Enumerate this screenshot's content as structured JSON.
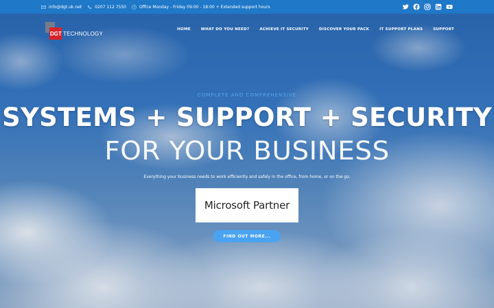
{
  "topbar": {
    "email": "info@dgt.uk.net",
    "phone": "0207 112 7550",
    "hours": "Office Monday - Friday 09:00 - 18:00 + Extended support hours",
    "social_icons": [
      "twitter-icon",
      "facebook-icon",
      "instagram-icon",
      "linkedin-icon",
      "youtube-icon"
    ]
  },
  "logo": {
    "mark_text": "DGT",
    "text": "TECHNOLOGY"
  },
  "nav": {
    "items": [
      {
        "label": "HOME"
      },
      {
        "label": "WHAT DO YOU NEED?"
      },
      {
        "label": "ACHIEVE IT SECURITY"
      },
      {
        "label": "DISCOVER YOUR PACK"
      },
      {
        "label": "IT SUPPORT PLANS"
      },
      {
        "label": "SUPPORT"
      }
    ]
  },
  "hero": {
    "eyebrow": "COMPLETE AND COMPREHENSIVE",
    "headline": "SYSTEMS + SUPPORT + SECURITY",
    "subheadline": "FOR YOUR BUSINESS",
    "lede": "Everything your business needs to work efficiently and safely in the office, from home, or on the go.",
    "partner_badge": "Microsoft Partner",
    "cta_label": "FIND OUT MORE..."
  },
  "colors": {
    "topbar": "#1f78c8",
    "accent": "#4aa3f0",
    "logo_red": "#d7232a",
    "eyebrow": "#5aa7ec"
  }
}
